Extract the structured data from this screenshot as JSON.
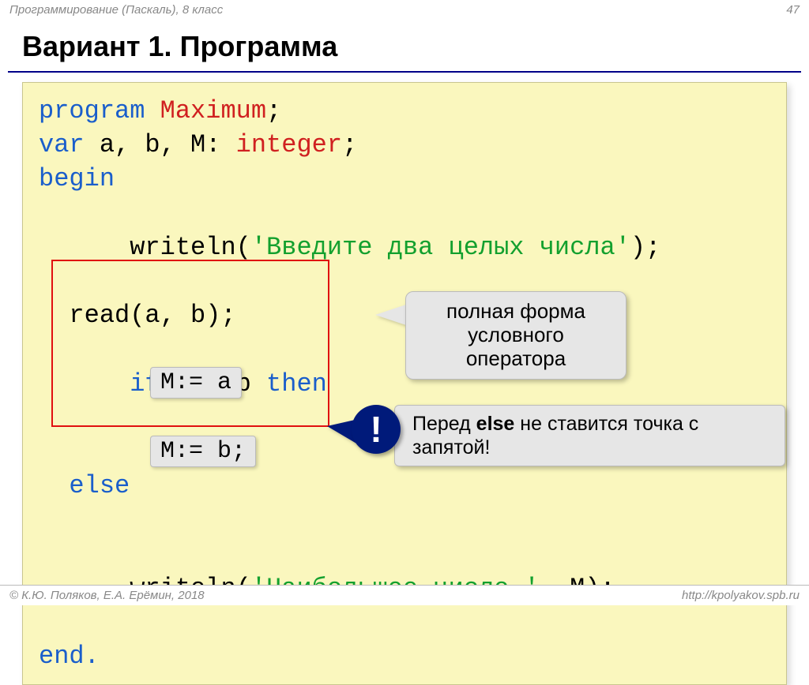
{
  "header": {
    "left": "Программирование (Паскаль), 8 класс",
    "page": "47"
  },
  "title": "Вариант 1. Программа",
  "code": {
    "l1_kw": "program ",
    "l1_name": "Maximum",
    "l1_semi": ";",
    "l2_kw": "var ",
    "l2_vars": "a, b, M: ",
    "l2_type": "integer",
    "l2_semi": ";",
    "l3": "begin",
    "l4_call": "  writeln(",
    "l4_str": "'Введите два целых числа'",
    "l4_end": ");",
    "l5": "  read(a, b);",
    "l6_if": "  if ",
    "l6_cond": "a > b ",
    "l6_then": "then",
    "l7": "",
    "l8_else": "  else",
    "l9": "",
    "l10_call": "  writeln(",
    "l10_str": "'Наибольшее число '",
    "l10_end": ", M);",
    "l11": "end."
  },
  "chips": {
    "a": "M:= a",
    "b": "M:= b;"
  },
  "callouts": {
    "top": "полная форма\nусловного\nоператора",
    "bang": "!",
    "note_pre": "Перед ",
    "note_bold": "else",
    "note_post": " не ставится точка с запятой!"
  },
  "footer": {
    "left": "© К.Ю. Поляков, Е.А. Ерёмин, 2018",
    "right": "http://kpolyakov.spb.ru"
  }
}
